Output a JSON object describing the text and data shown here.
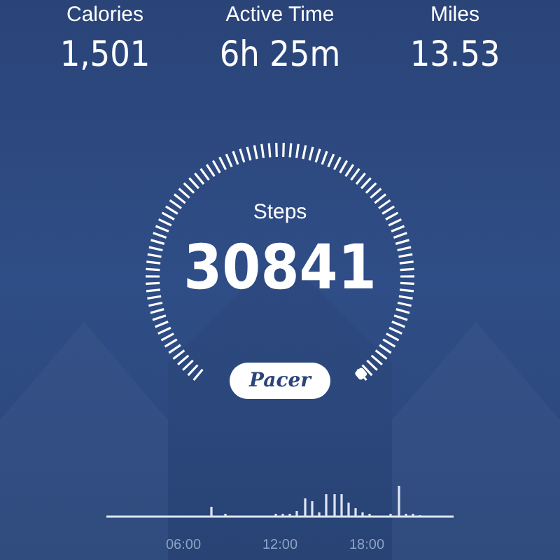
{
  "stats": [
    {
      "label": "Calories",
      "value": "1,501"
    },
    {
      "label": "Active Time",
      "value": "6h 25m"
    },
    {
      "label": "Miles",
      "value": "13.53"
    }
  ],
  "steps": {
    "label": "Steps",
    "value": "30841"
  },
  "brand_button": {
    "label": "Pacer"
  },
  "activity_chart": {
    "x_labels": [
      "06:00",
      "12:00",
      "18:00"
    ]
  }
}
